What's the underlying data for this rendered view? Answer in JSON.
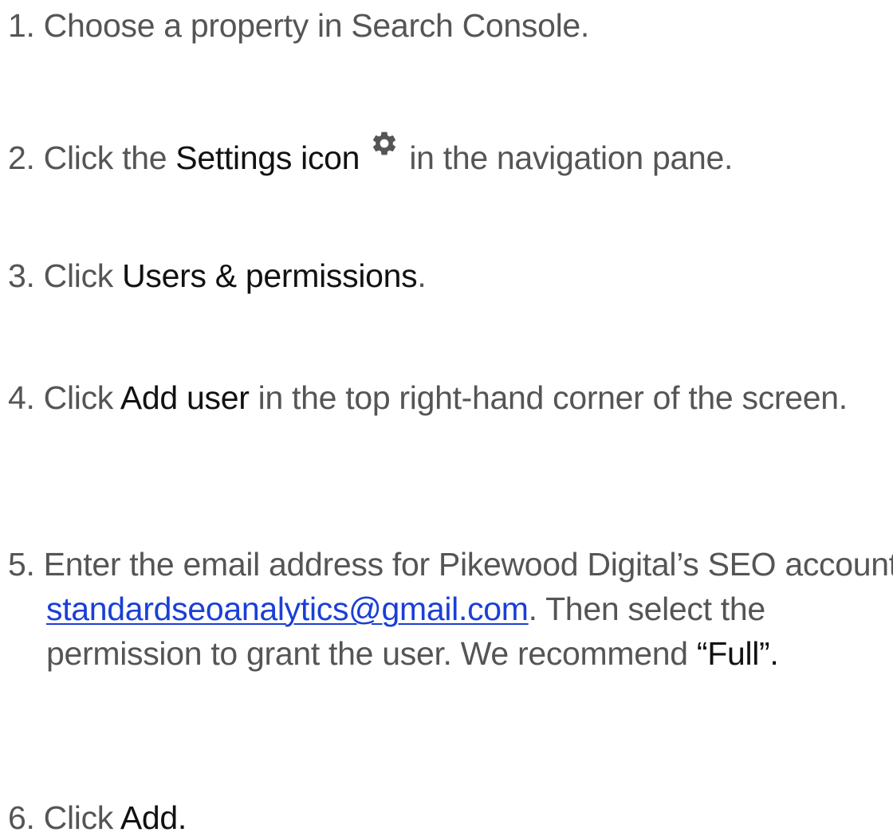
{
  "steps": [
    {
      "number": "1.",
      "parts": {
        "a": " Choose a property in Search Console."
      }
    },
    {
      "number": "2.",
      "parts": {
        "a": " Click the ",
        "b": "Settings icon",
        "c": " in the navigation pane."
      },
      "icon": "gear-icon"
    },
    {
      "number": "3.",
      "parts": {
        "a": " Click ",
        "b": "Users & permissions",
        "c": "."
      }
    },
    {
      "number": "4.",
      "parts": {
        "a": " Click ",
        "b": "Add user",
        "c": " in the top right-hand corner of the screen."
      }
    },
    {
      "number": "5.",
      "parts": {
        "a": " Enter the email address for Pikewood Digital’s SEO account, ",
        "link": "standardseoanalytics@gmail.com",
        "c": ". Then select the permission to grant the user. We recommend ",
        "d": "“Full”."
      }
    },
    {
      "number": "6.",
      "parts": {
        "a": " Click ",
        "b": "Add."
      }
    }
  ],
  "colors": {
    "body_text": "#555555",
    "emphasis_text": "#111111",
    "link": "#1a3fd6",
    "gear_icon": "#555555"
  }
}
